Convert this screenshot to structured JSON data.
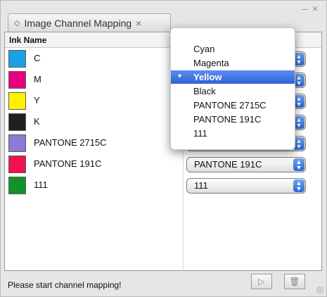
{
  "window": {
    "minimize": "–",
    "close": "×"
  },
  "tab": {
    "title": "Image Channel Mapping",
    "close": "×"
  },
  "list": {
    "header": {
      "ink_name": "Ink Name"
    },
    "rows": [
      {
        "name": "C",
        "swatch": "#1ba1e2",
        "mapped": "Cyan"
      },
      {
        "name": "M",
        "swatch": "#e6007e",
        "mapped": "Magenta"
      },
      {
        "name": "Y",
        "swatch": "#fff200",
        "mapped": "Yellow"
      },
      {
        "name": "K",
        "swatch": "#231f20",
        "mapped": "Black"
      },
      {
        "name": "PANTONE 2715C",
        "swatch": "#8a7bd4",
        "mapped": "PANTONE 2715C"
      },
      {
        "name": "PANTONE 191C",
        "swatch": "#f0134f",
        "mapped": "PANTONE 191C"
      },
      {
        "name": "111",
        "swatch": "#12922b",
        "mapped": "111"
      }
    ]
  },
  "dropdown": {
    "items": [
      "Cyan",
      "Magenta",
      "Yellow",
      "Black",
      "PANTONE 2715C",
      "PANTONE 191C",
      "111"
    ],
    "selected_index": 2,
    "selected_marker": "*"
  },
  "status": {
    "text": "Please start channel mapping!"
  }
}
